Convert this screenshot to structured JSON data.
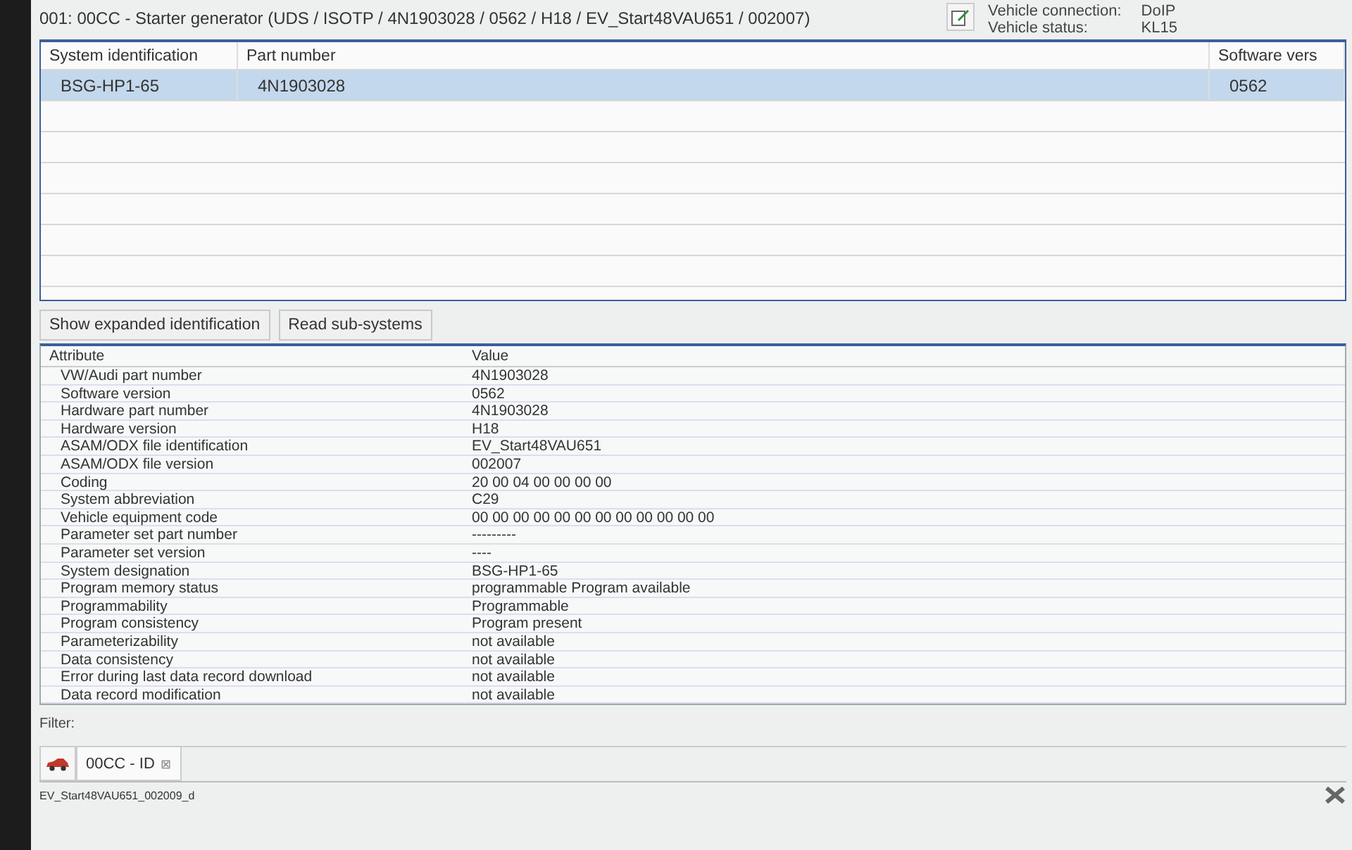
{
  "header": {
    "title": "001: 00CC - Starter generator  (UDS / ISOTP / 4N1903028 / 0562 / H18 / EV_Start48VAU651 / 002007)",
    "connection_label": "Vehicle connection:",
    "connection_value": "DoIP",
    "status_label": "Vehicle status:",
    "status_value": "KL15"
  },
  "systems_table": {
    "columns": [
      "System identification",
      "Part number",
      "Software vers"
    ],
    "rows": [
      {
        "cells": [
          "BSG-HP1-65",
          "4N1903028",
          "0562"
        ],
        "selected": true
      }
    ]
  },
  "buttons": [
    "Show expanded identification",
    "Read sub-systems"
  ],
  "attributes_table": {
    "columns": [
      "Attribute",
      "Value"
    ],
    "rows": [
      {
        "attribute": "VW/Audi part number",
        "value": "4N1903028"
      },
      {
        "attribute": "Software version",
        "value": "0562"
      },
      {
        "attribute": "Hardware part number",
        "value": "4N1903028"
      },
      {
        "attribute": "Hardware version",
        "value": "H18"
      },
      {
        "attribute": "ASAM/ODX file identification",
        "value": "EV_Start48VAU651"
      },
      {
        "attribute": "ASAM/ODX file version",
        "value": "002007"
      },
      {
        "attribute": "Coding",
        "value": "20 00 04 00 00 00 00"
      },
      {
        "attribute": "System abbreviation",
        "value": "C29"
      },
      {
        "attribute": "Vehicle equipment code",
        "value": "00 00 00 00 00 00 00 00 00 00 00 00"
      },
      {
        "attribute": "Parameter set part number",
        "value": "---------"
      },
      {
        "attribute": "Parameter set version",
        "value": "----"
      },
      {
        "attribute": "System designation",
        "value": "BSG-HP1-65"
      },
      {
        "attribute": "Program memory status",
        "value": "programmable Program available"
      },
      {
        "attribute": "Programmability",
        "value": "Programmable"
      },
      {
        "attribute": "Program consistency",
        "value": "Program present"
      },
      {
        "attribute": "Parameterizability",
        "value": "not available"
      },
      {
        "attribute": "Data consistency",
        "value": "not available"
      },
      {
        "attribute": "Error during last data record download",
        "value": "not available"
      },
      {
        "attribute": "Data record modification",
        "value": "not available"
      }
    ]
  },
  "filter": {
    "label": "Filter:"
  },
  "tabs": [
    {
      "label": "00CC - ID",
      "selected": true,
      "close": "⊠"
    }
  ],
  "status_bar": {
    "text": "EV_Start48VAU651_002009_d"
  }
}
